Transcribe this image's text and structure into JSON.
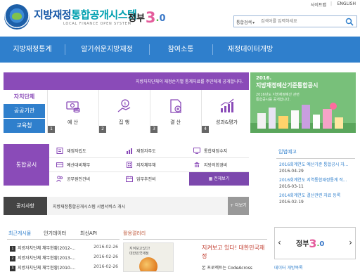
{
  "util": {
    "sitemap": "사이트맵",
    "separator": "|",
    "english": "ENGLISH"
  },
  "header": {
    "title_a": "지방재정",
    "title_b": "통합공개시스템",
    "subtitle": "LOCAL FINANCE OPEN SYSTEM",
    "gov_text": "정부",
    "gov_num": "3",
    "gov_dot": ".",
    "gov_zero": "0"
  },
  "search": {
    "select": "통합검색",
    "placeholder": "검색어를 입력하세요"
  },
  "nav": {
    "items": [
      "지방재정통계",
      "알기쉬운지방재정",
      "참여소통",
      "재정데이터개방"
    ]
  },
  "banner": {
    "text": "지방자치단체의 재정순기별 통계자료를 주민에게 공개합니다."
  },
  "categories": [
    "자치단체",
    "공공기관",
    "교육청"
  ],
  "tiles": [
    {
      "label": "예 산",
      "num": "1",
      "icon": "money-icon"
    },
    {
      "label": "집 행",
      "num": "2",
      "icon": "execution-icon"
    },
    {
      "label": "결 산",
      "num": "3",
      "icon": "settlement-icon"
    },
    {
      "label": "성과&평가",
      "num": "4",
      "icon": "performance-chart-icon"
    }
  ],
  "promo": {
    "year": "2016.",
    "title": "지방재정예산기준통합공시",
    "desc1": "2016년도 지방재정예산 관련",
    "desc2": "통합공시를 공개합니다."
  },
  "disclosure": {
    "head": "통합공시",
    "items": [
      "재정자립도",
      "재정자주도",
      "통합재정수지",
      "예산대비채무",
      "지자체부채",
      "지방의회경비",
      "공무원인건비",
      "업무추진비"
    ],
    "more": "전체보기"
  },
  "law": {
    "title": "입법예고",
    "items": [
      {
        "text": "2016회계연도 예산기준 통합공시 자...",
        "date": "2016-04-29"
      },
      {
        "text": "2016회계연도 지역통합재정통계 작...",
        "date": "2016-03-11"
      },
      {
        "text": "2014회계연도 결산관련 자료 등록",
        "date": "2016-02-19"
      }
    ]
  },
  "notice": {
    "head": "공지사항",
    "text": "지방재정통합공개시스템 시범서비스 개시",
    "more": "더보기"
  },
  "recent": {
    "tabs": [
      "최근게시물",
      "인기데이터",
      "최신API"
    ],
    "rows": [
      {
        "rank": "1",
        "text": "지방자치단체 채무현황(2012-...",
        "date": "2016-02-26"
      },
      {
        "rank": "2",
        "text": "지방자치단체 채무현황(2013-...",
        "date": "2016-02-26"
      },
      {
        "rank": "3",
        "text": "지방자치단체 채무현황(2010-...",
        "date": "2016-02-26"
      }
    ]
  },
  "gallery": {
    "title": "활용갤러리",
    "thumb_line1": "지켜보고있다!",
    "thumb_line2": "대한민국재정",
    "caption1": "지켜보고 있다! 대한민국재",
    "caption2": "정",
    "more": "본 프로젝트는 CodeAcross"
  },
  "gov_banner": {
    "prev": "‹",
    "next": "›",
    "text": "정부",
    "num": "3",
    "dot": ".",
    "zero": "0",
    "bottom": "데이터 개방목록"
  },
  "colors": {
    "nav": "#2f7fcc",
    "purple": "#8a4bb8",
    "promo": "#78c07a"
  }
}
